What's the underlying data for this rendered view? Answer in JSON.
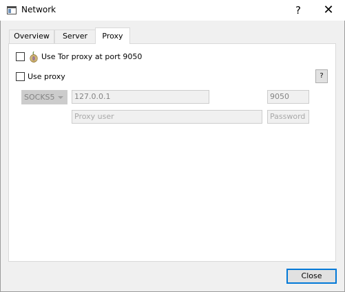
{
  "window": {
    "title": "Network",
    "help_glyph": "?",
    "close_glyph": "✕"
  },
  "tabs": [
    {
      "label": "Overview"
    },
    {
      "label": "Server"
    },
    {
      "label": "Proxy",
      "active": true
    }
  ],
  "proxy": {
    "tor_label": "Use Tor proxy at port 9050",
    "tor_checked": false,
    "tor_icon": "tor-onion-icon",
    "use_proxy_label": "Use proxy",
    "use_proxy_checked": false,
    "help_label": "?",
    "type_value": "SOCKS5",
    "host_value": "127.0.0.1",
    "port_value": "9050",
    "user_placeholder": "Proxy user",
    "password_placeholder": "Password"
  },
  "footer": {
    "close_label": "Close"
  },
  "colors": {
    "accent": "#0078d7",
    "disabled_text": "#838383"
  }
}
